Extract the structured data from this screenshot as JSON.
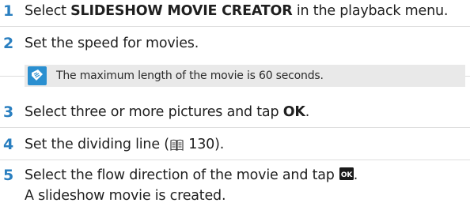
{
  "steps": [
    {
      "num": "1",
      "prefix": "Select ",
      "bold": "SLIDESHOW MOVIE CREATOR",
      "suffix": " in the playback menu."
    },
    {
      "num": "2",
      "text": "Set the speed for movies."
    },
    {
      "num": "3",
      "prefix": "Select three or more pictures and tap ",
      "bold": "OK",
      "suffix": "."
    },
    {
      "num": "4",
      "prefix": "Set the dividing line (",
      "ref": "130",
      "suffix": ")."
    },
    {
      "num": "5",
      "prefix": "Select the flow direction of the movie and tap",
      "suffix": ".",
      "line2": "A slideshow movie is created."
    }
  ],
  "note": {
    "text": "The maximum length of the movie is 60 seconds.",
    "icon": "memo-note-icon"
  },
  "ok_icon": {
    "label": "OK",
    "bg": "#1a1a1a",
    "fg": "#ffffff"
  },
  "colors": {
    "step_number": "#2a7fc0",
    "note_icon": "#2a8fd0",
    "rule": "#dedede",
    "note_bg": "#e9e9e9"
  }
}
